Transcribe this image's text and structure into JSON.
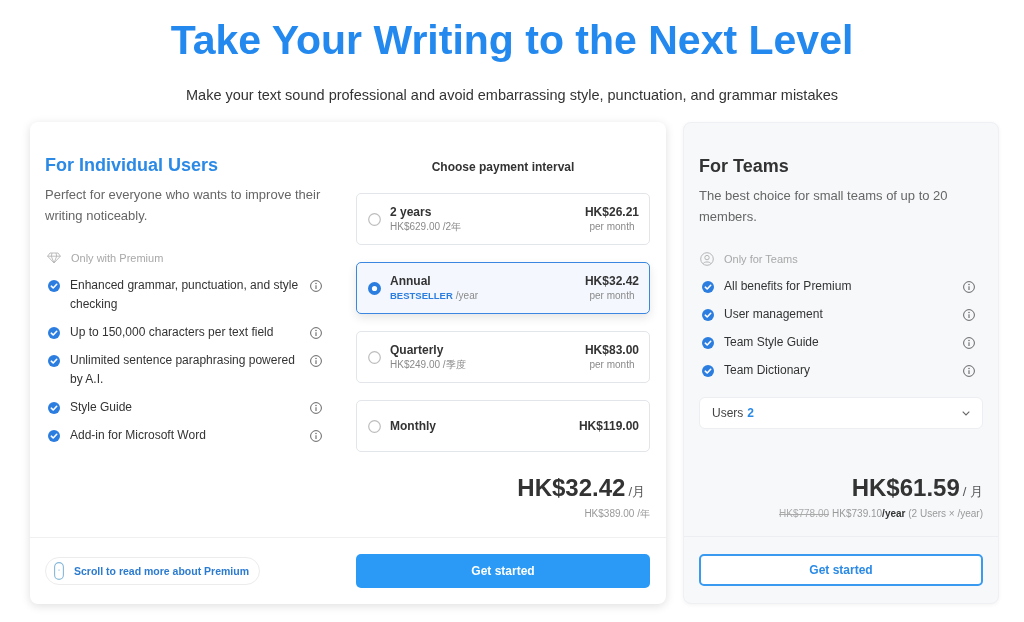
{
  "header": {
    "title": "Take Your Writing to the Next Level",
    "subtitle": "Make your text sound professional and avoid embarrassing style, punctuation, and grammar mistakes"
  },
  "individual_plan": {
    "title": "For Individual Users",
    "description": "Perfect for everyone who wants to improve their writing noticeably.",
    "note": "Only with Premium",
    "features": [
      {
        "text": "Enhanced grammar, punctuation, and style checking",
        "checked": true
      },
      {
        "text": "Up to 150,000 characters per text field",
        "checked": true
      },
      {
        "text": "Unlimited sentence paraphrasing powered by A.I.",
        "checked": true
      },
      {
        "text": "Style Guide",
        "checked": true
      },
      {
        "text": "Add-in for Microsoft Word",
        "checked": true
      }
    ],
    "interval_heading": "Choose payment interval",
    "intervals": [
      {
        "name": "2 years",
        "detail": "HK$629.00 /2年",
        "price": "HK$26.21",
        "period": "per month",
        "selected": false
      },
      {
        "name": "Annual",
        "badge": "BESTSELLER",
        "detail": "/year",
        "price": "HK$32.42",
        "period": "per month",
        "selected": true
      },
      {
        "name": "Quarterly",
        "detail": "HK$249.00 /季度",
        "price": "HK$83.00",
        "period": "per month",
        "selected": false
      },
      {
        "name": "Monthly",
        "price": "HK$119.00",
        "selected": false
      }
    ],
    "total": {
      "price": "HK$32.42",
      "unit": "/月",
      "billed": "HK$389.00 /年"
    },
    "scroll_hint": "Scroll to read more about Premium",
    "button": "Get started"
  },
  "team_plan": {
    "title": "For Teams",
    "description": "The best choice for small teams of up to 20 members.",
    "note": "Only for Teams",
    "features": [
      {
        "text": "All benefits for Premium",
        "checked": true
      },
      {
        "text": "User management",
        "checked": true
      },
      {
        "text": "Team Style Guide",
        "checked": true
      },
      {
        "text": "Team Dictionary",
        "checked": true
      }
    ],
    "users": {
      "label": "Users",
      "value": "2"
    },
    "total": {
      "price": "HK$61.59",
      "unit": "/ 月",
      "old_price": "HK$778.00",
      "billed": "HK$739.10**/year** (2 Users × /year)"
    },
    "button": "Get started"
  }
}
